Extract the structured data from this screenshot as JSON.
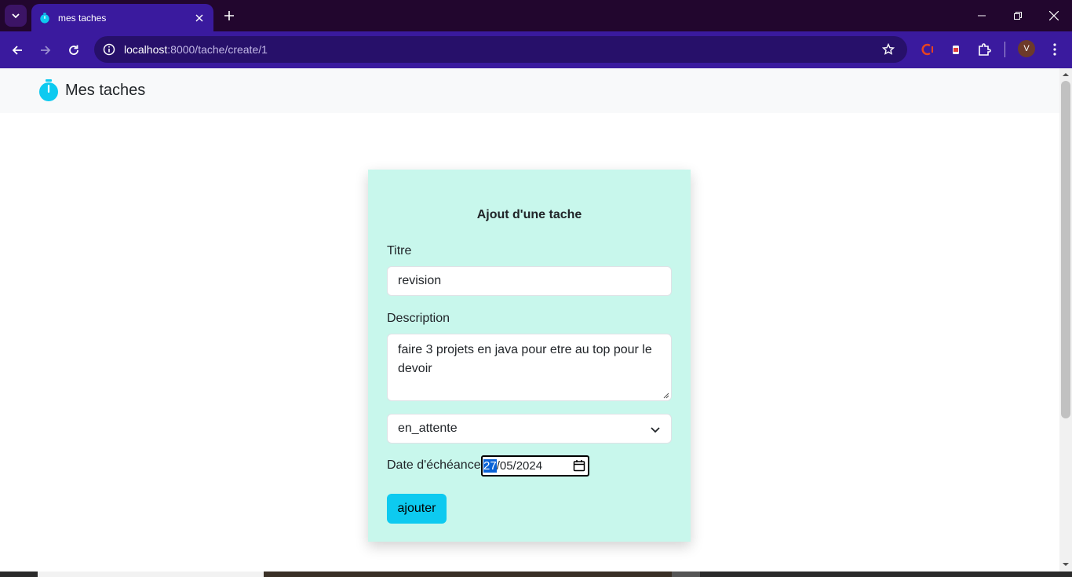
{
  "browser": {
    "tab_title": "mes taches",
    "url_host": "localhost",
    "url_path": ":8000/tache/create/1",
    "avatar_letter": "V",
    "accent": "#3a1a9e"
  },
  "navbar": {
    "brand": "Mes taches",
    "icon": "stopwatch-icon",
    "icon_color": "#0dcaf0"
  },
  "form": {
    "title": "Ajout d'une tache",
    "titre_label": "Titre",
    "titre_value": "revision",
    "description_label": "Description",
    "description_value": "faire 3 projets en java pour etre au top pour le devoir",
    "status_value": "en_attente",
    "date_label": "Date d'échéance",
    "date_day": "27",
    "date_rest": "/05/2024",
    "submit_label": "ajouter",
    "card_color": "#c8f7ec",
    "button_color": "#0dcaf0"
  }
}
